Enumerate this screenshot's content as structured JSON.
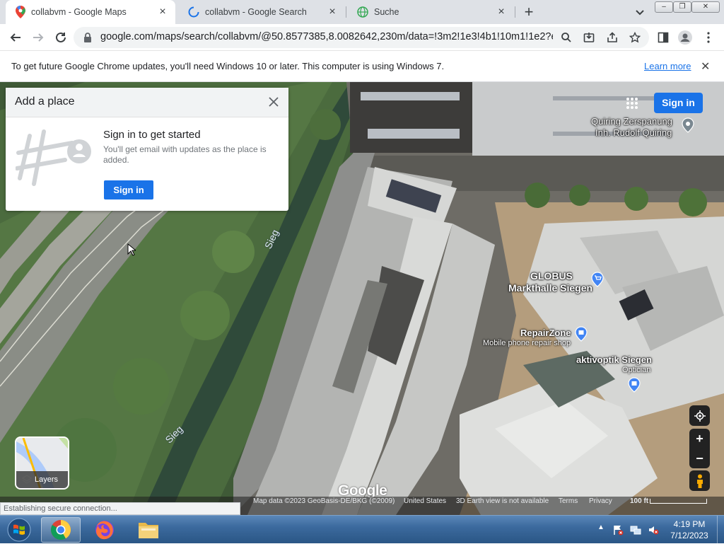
{
  "tabs": [
    {
      "title": "collabvm - Google Maps",
      "active": true,
      "icon": "maps-pin-icon"
    },
    {
      "title": "collabvm - Google Search",
      "active": false,
      "icon": "loading-spinner-icon"
    },
    {
      "title": "Suche",
      "active": false,
      "icon": "globe-icon"
    }
  ],
  "toolbar": {
    "url": "google.com/maps/search/collabvm/@50.8577385,8.0082642,230m/data=!3m2!1e3!4b1!10m1!1e2?ent..."
  },
  "infobar": {
    "message": "To get future Google Chrome updates, you'll need Windows 10 or later. This computer is using Windows 7.",
    "link": "Learn more"
  },
  "card": {
    "header": "Add a place",
    "title": "Sign in to get started",
    "description": "You'll get email with updates as the place is added.",
    "button": "Sign in"
  },
  "map": {
    "signin_label": "Sign in",
    "pois": [
      {
        "name": "Quiring Zerspanung",
        "name2": "Inh. Rudolf Quiring"
      },
      {
        "name": "GLOBUS",
        "name2": "Markthalle Siegen"
      },
      {
        "name": "RepairZone",
        "sub": "Mobile phone repair shop"
      },
      {
        "name": "aktivoptik Siegen",
        "sub": "Optician"
      }
    ],
    "rivers": [
      "Sieg",
      "Sieg"
    ],
    "layers_label": "Layers",
    "logo": "Google",
    "attribution": {
      "data": "Map data ©2023 GeoBasis-DE/BKG (©2009)",
      "country": "United States",
      "earth": "3D Earth view is not available",
      "terms": "Terms",
      "privacy": "Privacy",
      "scale": "100 ft"
    },
    "status": "Establishing secure connection..."
  },
  "taskbar": {
    "apps": [
      "windows-start-icon",
      "chrome-icon",
      "firefox-icon",
      "file-explorer-icon"
    ],
    "time": "4:19 PM",
    "date": "7/12/2023"
  },
  "colors": {
    "accent": "#1a73e8",
    "tabstrip": "#dee1e6"
  }
}
